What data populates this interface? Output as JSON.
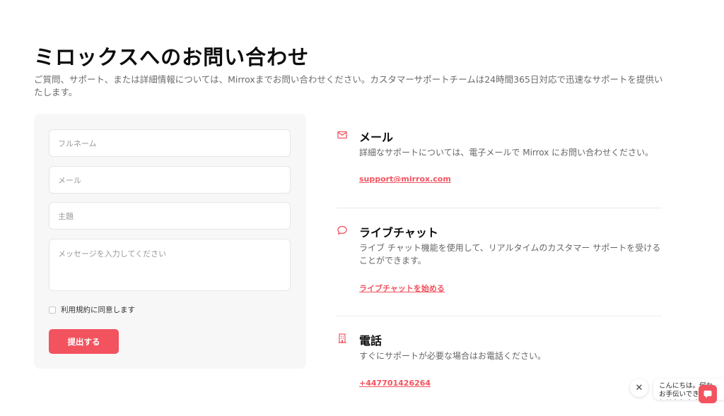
{
  "header": {
    "title": "ミロックスへのお問い合わせ",
    "description": "ご質問、サポート、または詳細情報については、Mirroxまでお問い合わせください。カスタマーサポートチームは24時間365日対応で迅速なサポートを提供いたします。"
  },
  "form": {
    "name_placeholder": "フルネーム",
    "email_placeholder": "メール",
    "subject_placeholder": "主題",
    "message_placeholder": "メッセージを入力してください",
    "terms_label": "利用規約に同意します",
    "submit_label": "提出する"
  },
  "contacts": [
    {
      "icon": "mail-icon",
      "title": "メール",
      "description": "詳細なサポートについては、電子メールで Mirrox にお問い合わせください。",
      "link": "support@mirrox.com"
    },
    {
      "icon": "chat-bubble-icon",
      "title": "ライブチャット",
      "description": "ライブ チャット機能を使用して、リアルタイムのカスタマー サポートを受けることができます。",
      "link": "ライブチャットを始める"
    },
    {
      "icon": "building-icon",
      "title": "電話",
      "description": "すぐにサポートが必要な場合はお電話ください。",
      "link": "+447701426264"
    }
  ],
  "chat_widget": {
    "greeting": "こんにちは。何かお手伝いできることはありますか？",
    "close_symbol": "✕"
  },
  "colors": {
    "accent": "#f2535f",
    "card_bg": "#f7f7f7",
    "muted_text": "#6b6b6b"
  }
}
